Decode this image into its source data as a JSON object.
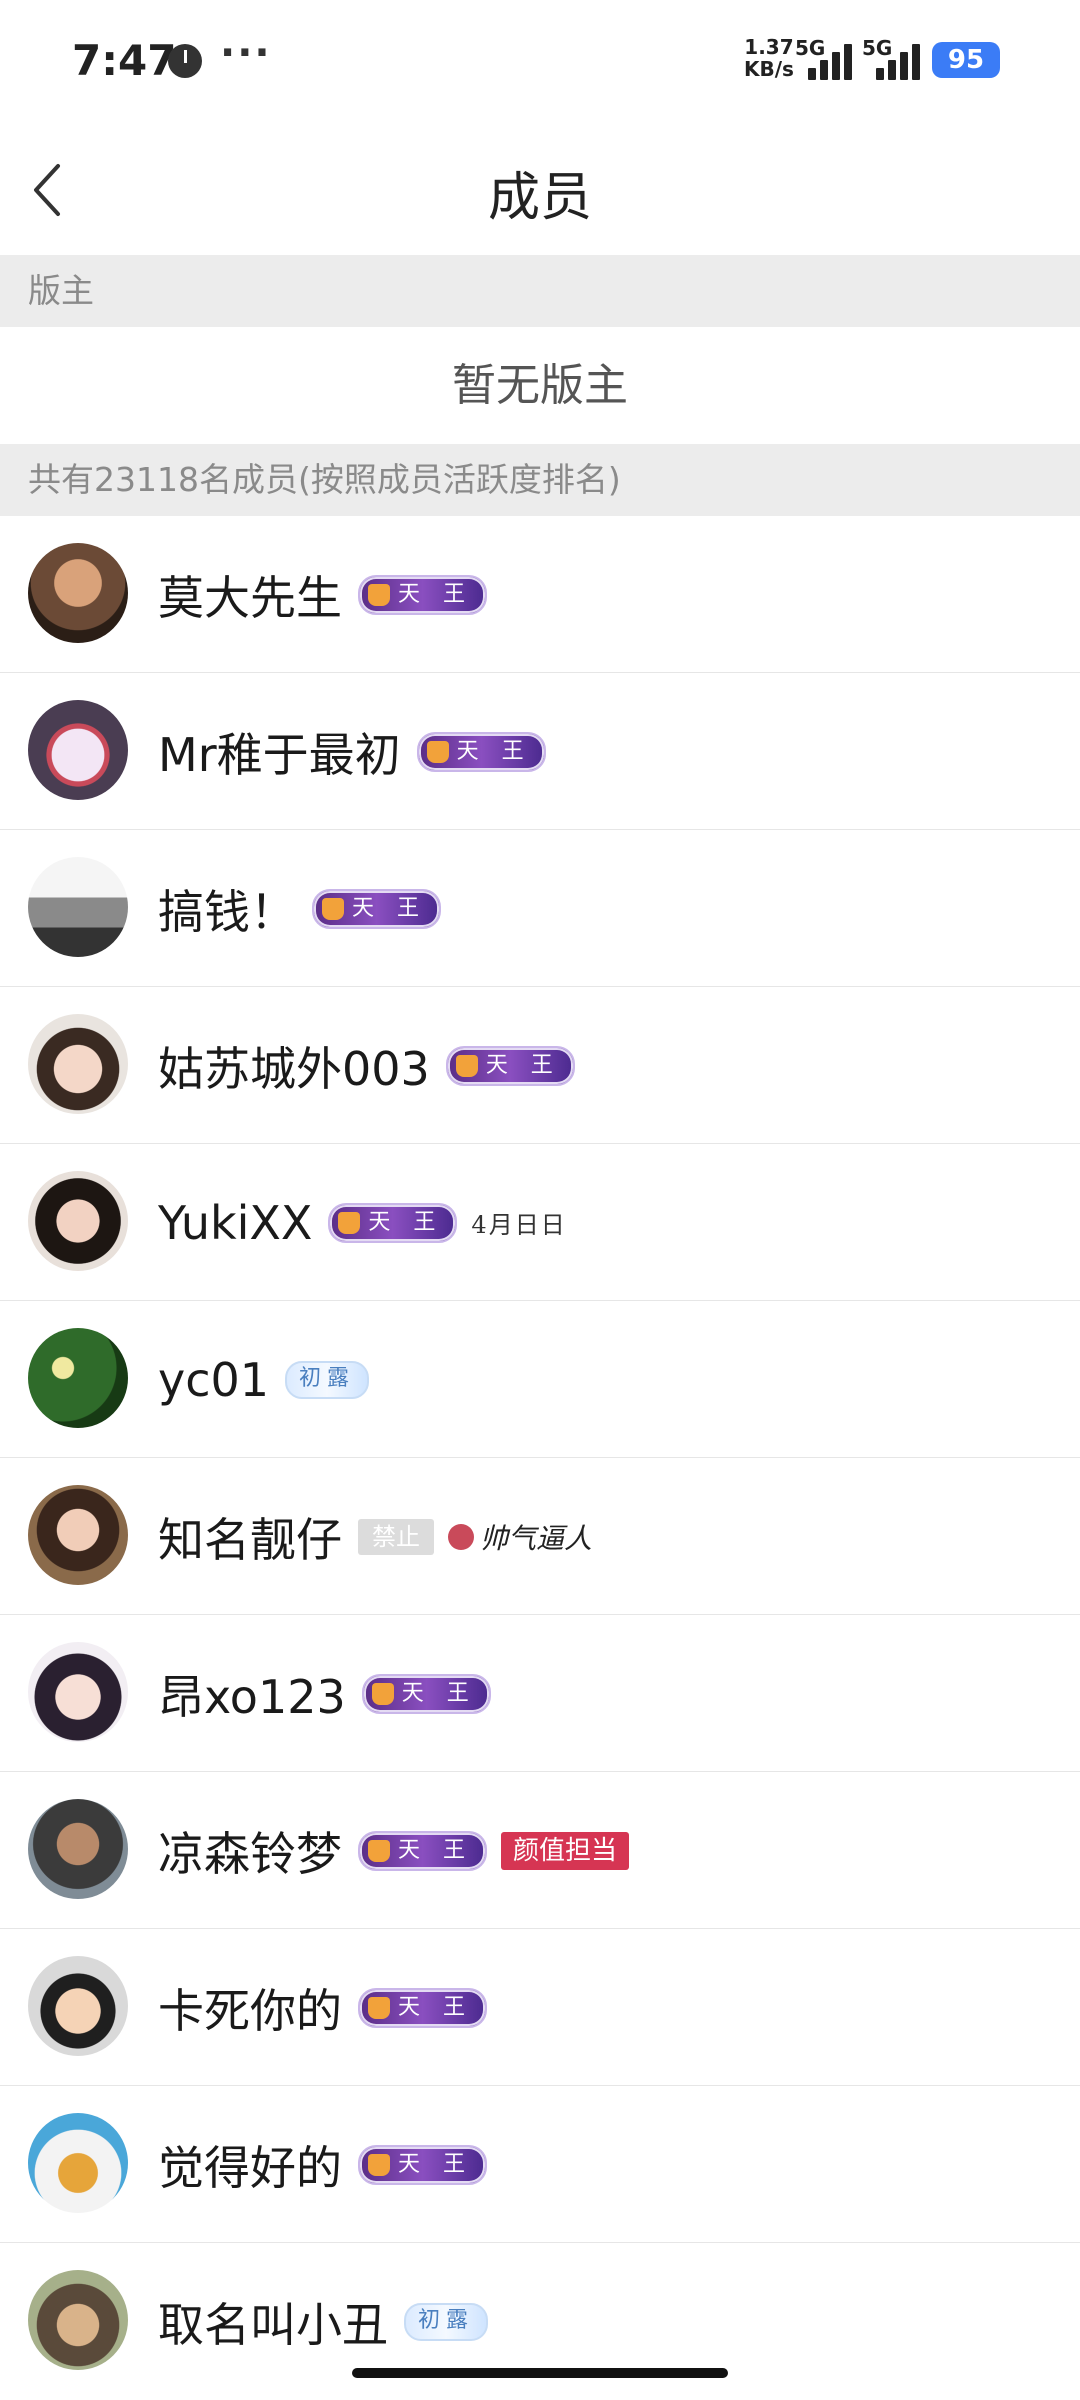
{
  "status_bar": {
    "time": "7:47",
    "more": "···",
    "net_speed_value": "1.37",
    "net_speed_unit": "KB/s",
    "sim1_label": "5G",
    "sim2_label": "5G",
    "battery": "95",
    "battery_color": "#3b7cf6"
  },
  "header": {
    "back_icon": "chevron-left-icon",
    "title": "成员"
  },
  "moderator_section": {
    "label": "版主",
    "empty_text": "暂无版主"
  },
  "members_section": {
    "label": "共有23118名成员(按照成员活跃度排名)"
  },
  "badges": {
    "tianwang": "天 王",
    "light": "初露",
    "banned": "禁止",
    "yanzhi": "颜值担当",
    "calendar": "4月日日",
    "script": "帅气逼人"
  },
  "members": [
    {
      "name": "莫大先生"
    },
    {
      "name": "Mr稚于最初"
    },
    {
      "name": "搞钱！"
    },
    {
      "name": "姑苏城外003"
    },
    {
      "name": "YukiXX"
    },
    {
      "name": "yc01"
    },
    {
      "name": "知名靓仔"
    },
    {
      "name": "昂xo123"
    },
    {
      "name": "凉森铃梦"
    },
    {
      "name": "卡死你的"
    },
    {
      "name": "觉得好的"
    },
    {
      "name": "取名叫小丑"
    }
  ]
}
